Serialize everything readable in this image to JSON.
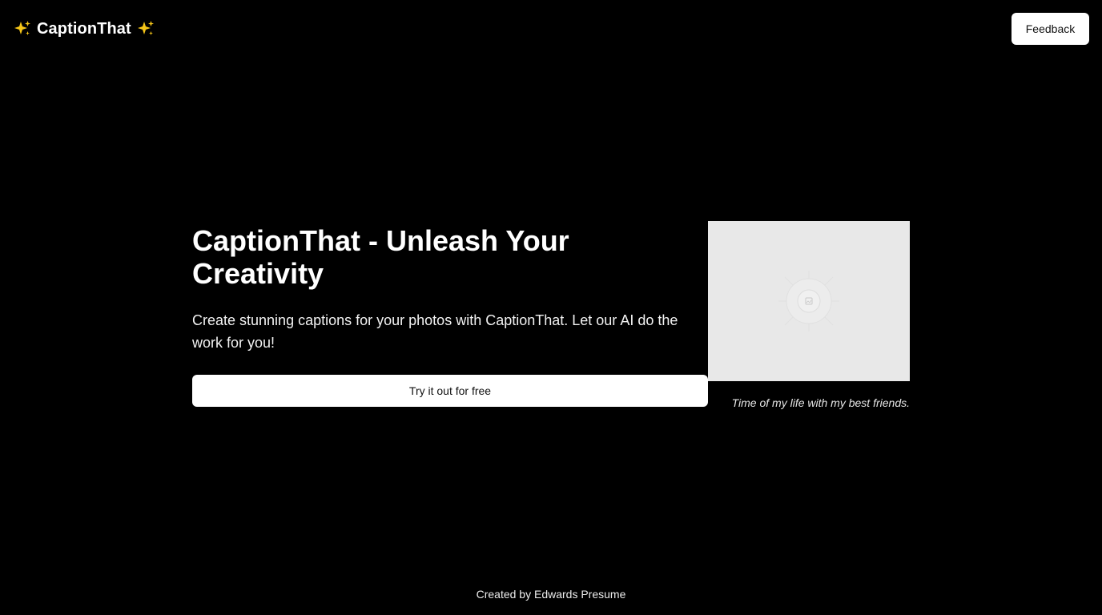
{
  "header": {
    "brand_name": "CaptionThat",
    "brand_icon": "sparkles-icon",
    "feedback_label": "Feedback"
  },
  "hero": {
    "title": "CaptionThat - Unleash Your Creativity",
    "description": "Create stunning captions for your photos with CaptionThat. Let our AI do the work for you!",
    "cta_label": "Try it out for free"
  },
  "example": {
    "image_icon": "image-placeholder-icon",
    "caption": "Time of my life with my best friends."
  },
  "footer": {
    "credit": "Created by Edwards Presume"
  },
  "colors": {
    "background": "#000000",
    "text": "#ffffff",
    "button_bg": "#ffffff",
    "button_text": "#111111",
    "sparkle": "#f5c518",
    "placeholder_bg": "#e8e8e8"
  }
}
